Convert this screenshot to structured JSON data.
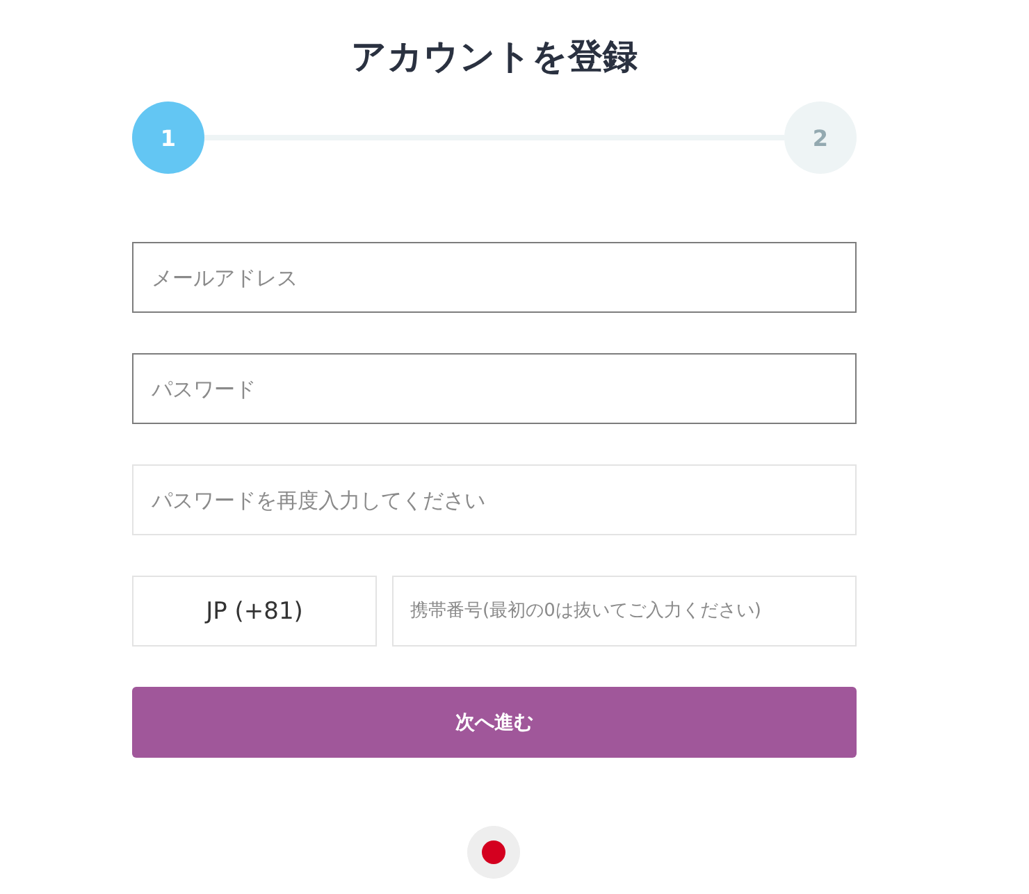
{
  "title": "アカウントを登録",
  "steps": [
    {
      "label": "1",
      "selected": true
    },
    {
      "label": "2",
      "selected": false
    }
  ],
  "fields": [
    {
      "placeholder": "メールアドレス",
      "outlined": true
    },
    {
      "placeholder": "パスワード",
      "outlined": true
    },
    {
      "placeholder": "パスワードを再度入力してください",
      "outlined": false
    }
  ],
  "phone": {
    "country_code": "JP (+81)",
    "placeholder": "携帯番号(最初の0は抜いてご入力ください)"
  },
  "submit_button": "次へ進む"
}
